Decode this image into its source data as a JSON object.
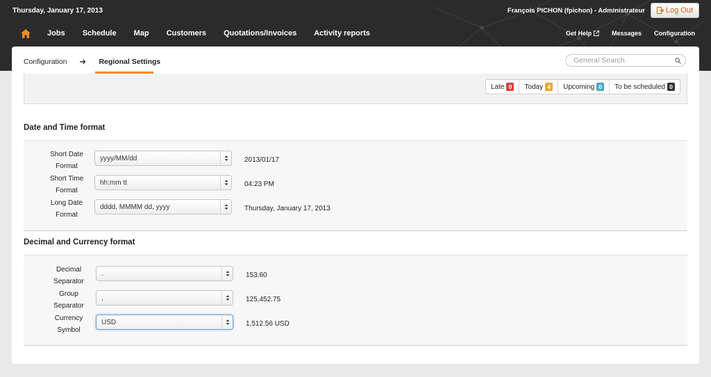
{
  "header": {
    "date": "Thursday, January 17, 2013",
    "user": "François PICHON (fpichon) - Administrateur",
    "logout_label": "Log Out",
    "accent_color": "#f08a24"
  },
  "nav": {
    "home_icon": "home-icon",
    "items": [
      "Jobs",
      "Schedule",
      "Map",
      "Customers",
      "Quotations/Invoices",
      "Activity reports"
    ],
    "right_items": [
      "Get Help",
      "Messages",
      "Configuration"
    ]
  },
  "breadcrumb": {
    "parent": "Configuration",
    "current": "Regional Settings"
  },
  "search": {
    "placeholder": "General Search"
  },
  "status": {
    "items": [
      {
        "label": "Late",
        "count": "0",
        "color": "#d9423e"
      },
      {
        "label": "Today",
        "count": "4",
        "color": "#f0a52c"
      },
      {
        "label": "Upcoming",
        "count": "0",
        "color": "#4aa7c9"
      },
      {
        "label": "To be scheduled",
        "count": "0",
        "color": "#333333"
      }
    ]
  },
  "sections": [
    {
      "title": "Date and Time format",
      "rows": [
        {
          "label_l1": "Short Date",
          "label_l2": "Format",
          "value": "yyyy/MM/dd",
          "preview": "2013/01/17"
        },
        {
          "label_l1": "Short Time",
          "label_l2": "Format",
          "value": "hh:mm tt",
          "preview": "04:23 PM"
        },
        {
          "label_l1": "Long Date",
          "label_l2": "Format",
          "value": "dddd, MMMM dd, yyyy",
          "preview": "Thursday, January 17, 2013"
        }
      ]
    },
    {
      "title": "Decimal and Currency format",
      "rows": [
        {
          "label_l1": "Decimal",
          "label_l2": "Separator",
          "value": ".",
          "preview": "153.60"
        },
        {
          "label_l1": "Group",
          "label_l2": "Separator",
          "value": ",",
          "preview": "125,452.75"
        },
        {
          "label_l1": "Currency",
          "label_l2": "Symbol",
          "value": "USD",
          "preview": "1,512.56 USD"
        }
      ]
    }
  ]
}
